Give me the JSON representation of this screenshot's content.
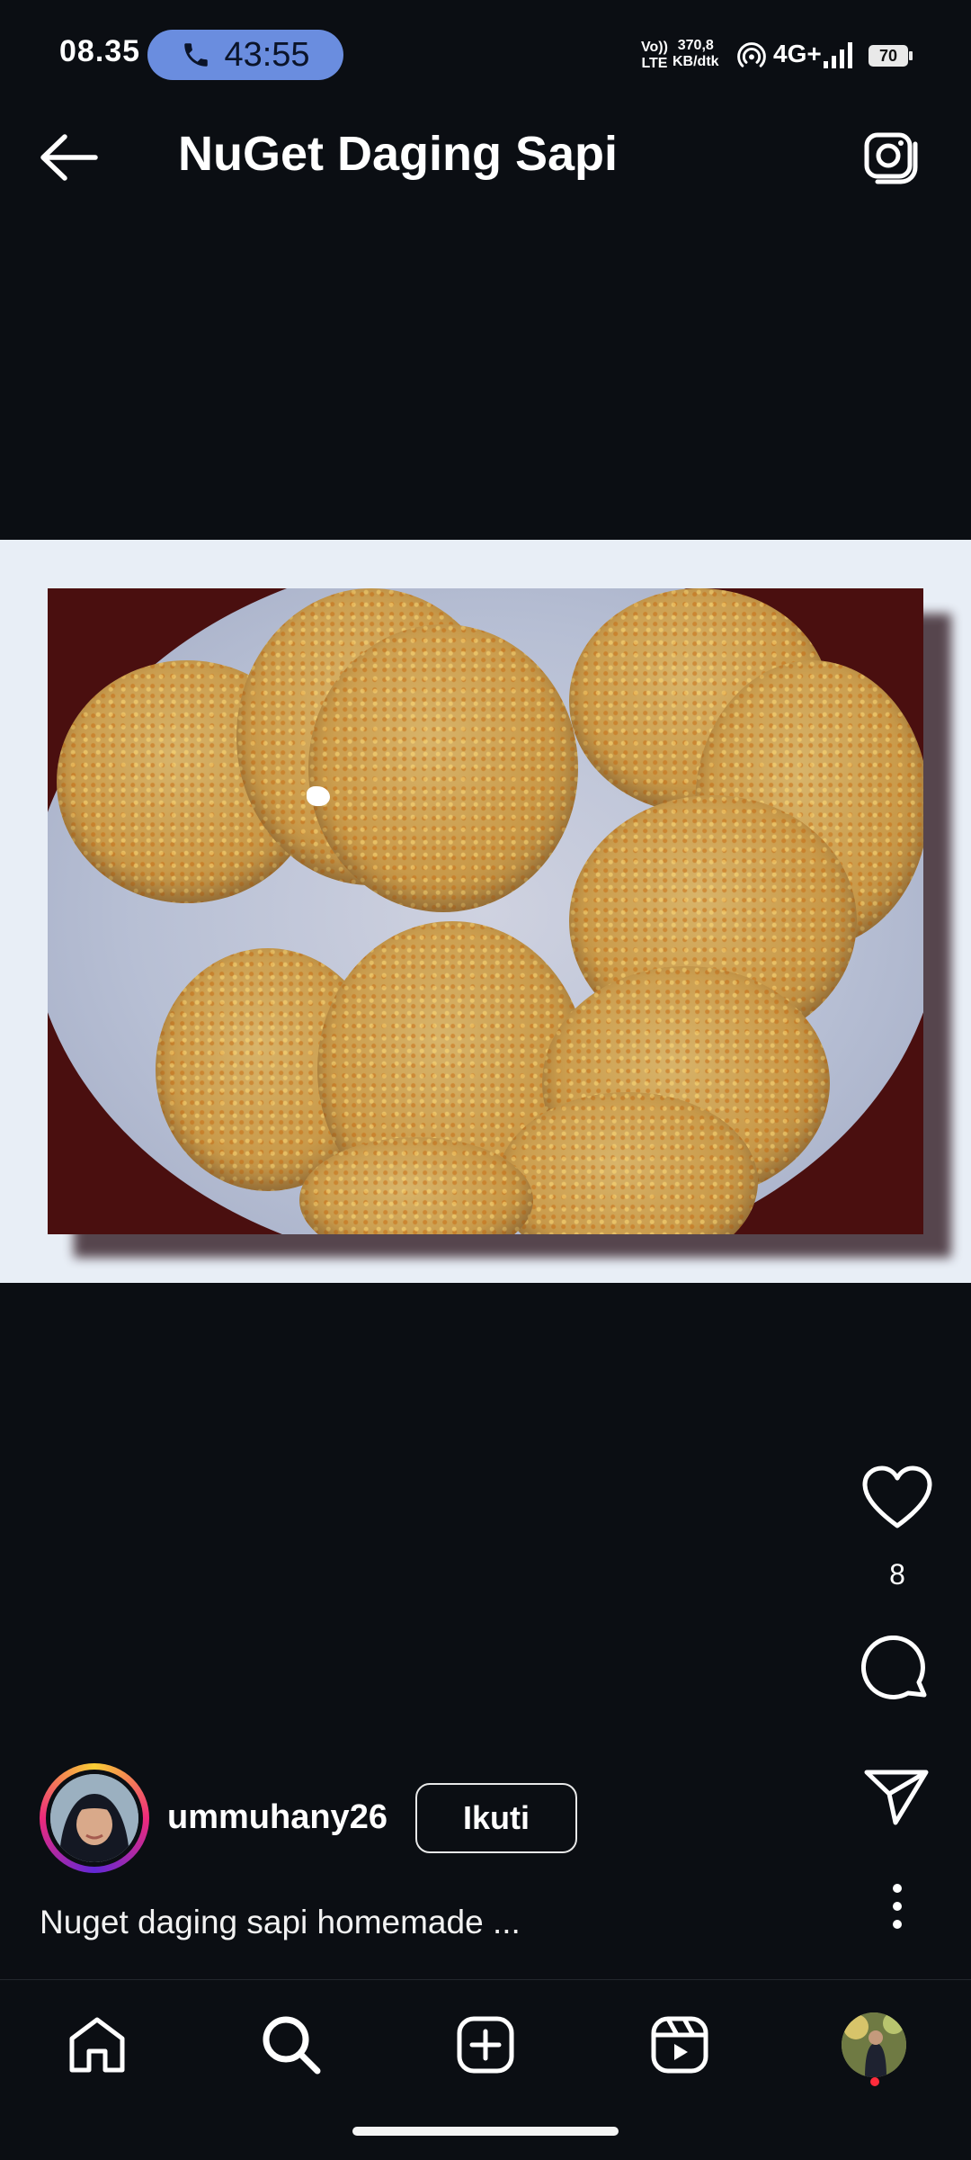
{
  "status_bar": {
    "time": "08.35",
    "call_timer": "43:55",
    "volte_line1": "Vo))",
    "volte_line2": "LTE",
    "net_speed_value": "370,8",
    "net_speed_unit": "KB/dtk",
    "net_type": "4G+",
    "battery": "70",
    "icons": [
      "phone-icon",
      "hotspot-icon",
      "signal-icon",
      "battery-icon"
    ]
  },
  "header": {
    "title": "NuGet Daging Sapi",
    "back_icon": "arrow-left",
    "camera_icon": "camera"
  },
  "post": {
    "like_count": "8",
    "author": {
      "username": "ummuhany26",
      "follow_label": "Ikuti"
    },
    "caption": "Nuget daging sapi homemade ..."
  },
  "bottom_nav": {
    "items": [
      "home",
      "search",
      "create",
      "reels",
      "profile"
    ],
    "active": "search"
  },
  "colors": {
    "background": "#0b0e13",
    "call_pill": "#6a8ddf",
    "notification_dot": "#ff2b3b"
  }
}
